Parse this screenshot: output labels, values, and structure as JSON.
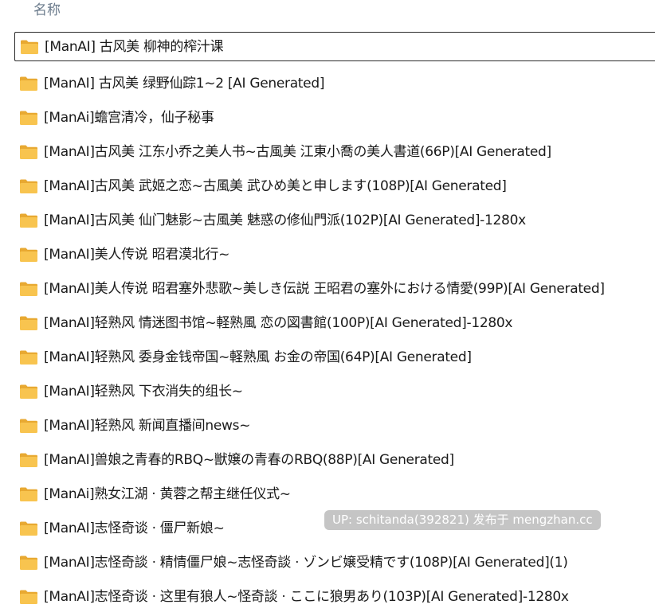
{
  "header": {
    "name_column": "名称"
  },
  "folders": [
    "[ManAI] 古风美 柳神的榨汁课",
    "[ManAI] 古风美 绿野仙踪1~2 [AI Generated]",
    "[ManAi]蟾宫清冷，仙子秘事",
    "[ManAI]古风美 江东小乔之美人书~古風美 江東小喬の美人書道(66P)[AI Generated]",
    "[ManAI]古风美 武姬之恋~古風美 武ひめ美と申します(108P)[AI Generated]",
    "[ManAI]古风美 仙门魅影~古風美 魅惑の修仙門派(102P)[AI Generated]-1280x",
    "[ManAI]美人传说 昭君漠北行~",
    "[ManAI]美人传说 昭君塞外悲歌~美しき伝説 王昭君の塞外における情愛(99P)[AI Generated]",
    "[ManAI]轻熟风 情迷图书馆~軽熟風 恋の図書館(100P)[AI Generated]-1280x",
    "[ManAI]轻熟风 委身金钱帝国~軽熟風 お金の帝国(64P)[AI Generated]",
    "[ManAI]轻熟风 下衣消失的组长~",
    "[ManAI]轻熟风 新闻直播间news~",
    "[ManAI]兽娘之青春的RBQ~獣嬢の青春のRBQ(88P)[AI Generated]",
    "[ManAi]熟女江湖 · 黄蓉之帮主继任仪式~",
    "[ManAI]志怪奇谈 · 僵尸新娘~",
    "[ManAI]志怪奇談 · 精情僵尸娘~志怪奇談 · ゾンビ嬢受精です(108P)[AI Generated](1)",
    "[ManAI]志怪奇谈 · 这里有狼人~怪奇談 · ここに狼男あり(103P)[AI Generated]-1280x"
  ],
  "watermark": "UP: schitanda(392821) 发布于 mengzhan.cc",
  "colors": {
    "folder_body": "#F8C44F",
    "folder_tab": "#E8A932",
    "header_text": "#6b7b8c"
  },
  "icons": {
    "folder": "folder-icon"
  }
}
